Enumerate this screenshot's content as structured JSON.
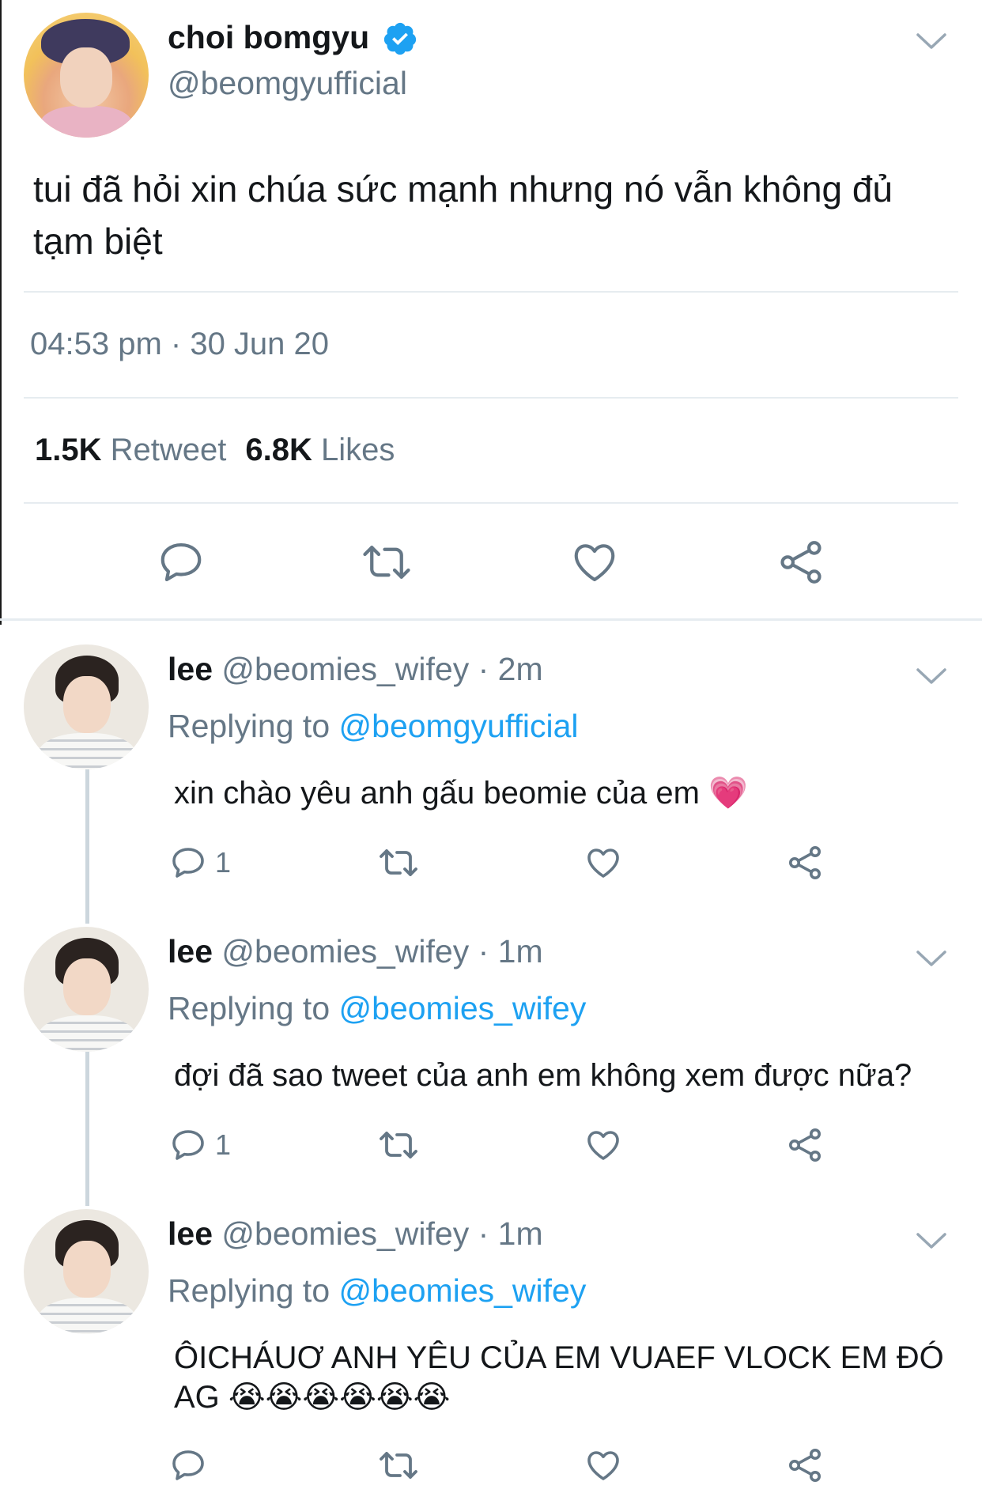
{
  "colors": {
    "accent": "#1da1f2",
    "muted": "#657786",
    "text": "#14171a",
    "divider": "#e6ecf0"
  },
  "main_tweet": {
    "name": "choi bomgyu",
    "handle": "@beomgyufficial",
    "text_line1": "tui đã hỏi xin chúa sức mạnh nhưng nó vẫn không đủ",
    "text_line2": "tạm biệt",
    "timestamp": "04:53 pm · 30 Jun 20",
    "retweets_count": "1.5K",
    "retweets_label": "Retweet",
    "likes_count": "6.8K",
    "likes_label": "Likes",
    "icons": [
      "reply-icon",
      "retweet-icon",
      "like-icon",
      "share-icon"
    ]
  },
  "replies": [
    {
      "name": "lee",
      "handle_time": "@beomies_wifey · 2m",
      "replying_prefix": "Replying to",
      "replying_to": "@beomgyufficial",
      "text": "xin chào yêu anh gấu beomie của em 💗",
      "reply_count": "1"
    },
    {
      "name": "lee",
      "handle_time": "@beomies_wifey · 1m",
      "replying_prefix": "Replying to",
      "replying_to": "@beomies_wifey",
      "text": "đợi đã sao tweet của anh em không xem được nữa?",
      "reply_count": "1"
    },
    {
      "name": "lee",
      "handle_time": "@beomies_wifey · 1m",
      "replying_prefix": "Replying to",
      "replying_to": "@beomies_wifey",
      "text": "ÔICHÁUƠ ANH YÊU CỦA EM VUAEF VLOCK EM ĐÓ AG 😭😭😭😭😭😭",
      "reply_count": ""
    }
  ]
}
